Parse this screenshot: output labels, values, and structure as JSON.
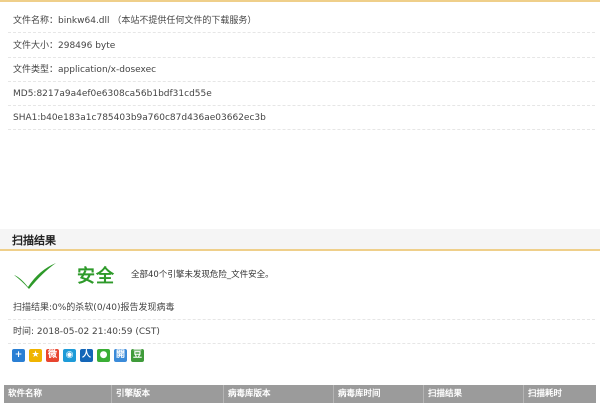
{
  "file_info": {
    "name": "文件名称：binkw64.dll （本站不提供任何文件的下载服务）",
    "size": "文件大小：298496 byte",
    "type": "文件类型：application/x-dosexec",
    "md5": "MD5:8217a9a4ef0e6308ca56b1bdf31cd55e",
    "sha1": "SHA1:b40e183a1c785403b9a760c87d436ae03662ec3b"
  },
  "scan": {
    "section_title": "扫描结果",
    "status_label": "安全",
    "summary": "全部40个引擎未发现危险_文件安全。",
    "result_text": "扫描结果:0%的杀软(0/40)报告发现病毒",
    "time_text": "时间: 2018-05-02 21:40:59 (CST)"
  },
  "share_icons": [
    "add-icon",
    "qzone-star-icon",
    "weibo-icon",
    "tencent-weibo-icon",
    "renren-icon",
    "wechat-icon",
    "kaixin-icon",
    "douban-icon"
  ],
  "colors": {
    "accent_border": "#efcf8a",
    "safe_green": "#2e9a2a",
    "table_header_bg": "#9b9b9b"
  },
  "table": {
    "columns": [
      "软件名称",
      "引擎版本",
      "病毒库版本",
      "病毒库时间",
      "扫描结果",
      "扫描耗时"
    ]
  }
}
